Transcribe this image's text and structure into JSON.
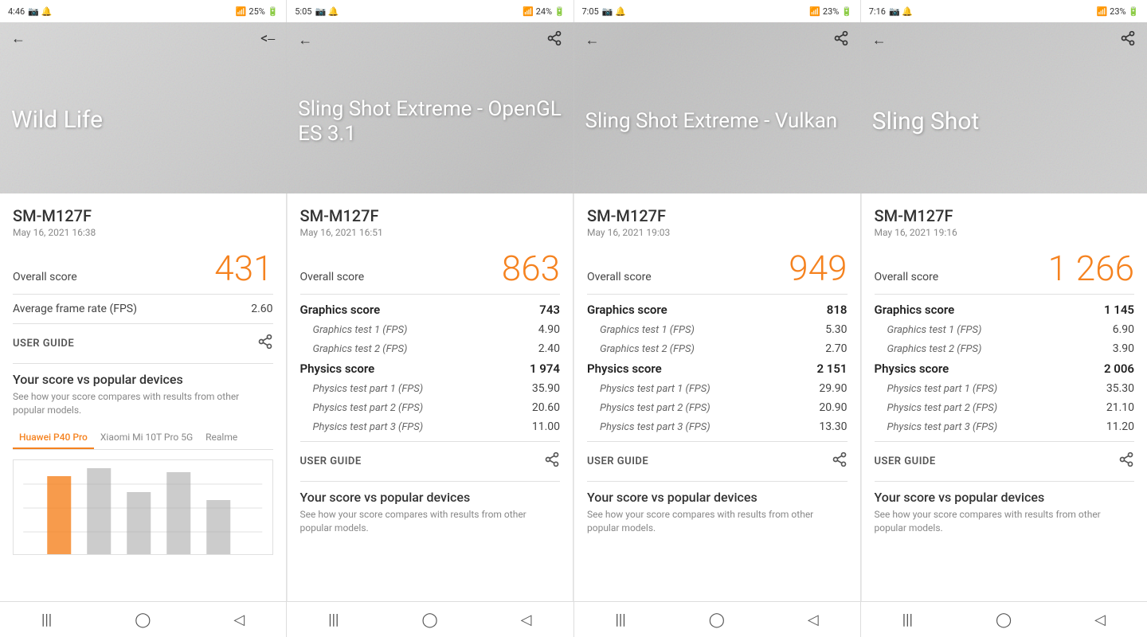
{
  "panels": [
    {
      "id": "wild-life",
      "statusTime": "4:46",
      "statusBattery": "25%",
      "headerTitle": "Wild Life",
      "deviceName": "SM-M127F",
      "deviceDate": "May 16, 2021 16:38",
      "overallLabel": "Overall score",
      "overallValue": "431",
      "avgFpsLabel": "Average frame rate (FPS)",
      "avgFpsValue": "2.60",
      "userGuideLabel": "USER GUIDE",
      "vsTitle": "Your score vs popular devices",
      "vsDesc": "See how your score compares with results from other popular models.",
      "tabs": [
        "Huawei P40 Pro",
        "Xiaomi Mi 10T Pro 5G",
        "Realme"
      ],
      "activeTab": 0,
      "showGraphics": false,
      "showPhysics": false
    },
    {
      "id": "sling-shot-opengl",
      "statusTime": "5:05",
      "statusBattery": "24%",
      "headerTitle": "Sling Shot Extreme - OpenGL ES 3.1",
      "deviceName": "SM-M127F",
      "deviceDate": "May 16, 2021 16:51",
      "overallLabel": "Overall score",
      "overallValue": "863",
      "graphicsLabel": "Graphics score",
      "graphicsValue": "743",
      "graphicsTest1Label": "Graphics test 1 (FPS)",
      "graphicsTest1Value": "4.90",
      "graphicsTest2Label": "Graphics test 2 (FPS)",
      "graphicsTest2Value": "2.40",
      "physicsLabel": "Physics score",
      "physicsValue": "1 974",
      "physicsTest1Label": "Physics test part 1 (FPS)",
      "physicsTest1Value": "35.90",
      "physicsTest2Label": "Physics test part 2 (FPS)",
      "physicsTest2Value": "20.60",
      "physicsTest3Label": "Physics test part 3 (FPS)",
      "physicsTest3Value": "11.00",
      "userGuideLabel": "USER GUIDE",
      "vsTitle": "Your score vs popular devices",
      "vsDesc": "See how your score compares with results from other popular models.",
      "showGraphics": true,
      "showPhysics": true
    },
    {
      "id": "sling-shot-vulkan",
      "statusTime": "7:05",
      "statusBattery": "23%",
      "headerTitle": "Sling Shot Extreme - Vulkan",
      "deviceName": "SM-M127F",
      "deviceDate": "May 16, 2021 19:03",
      "overallLabel": "Overall score",
      "overallValue": "949",
      "graphicsLabel": "Graphics score",
      "graphicsValue": "818",
      "graphicsTest1Label": "Graphics test 1 (FPS)",
      "graphicsTest1Value": "5.30",
      "graphicsTest2Label": "Graphics test 2 (FPS)",
      "graphicsTest2Value": "2.70",
      "physicsLabel": "Physics score",
      "physicsValue": "2 151",
      "physicsTest1Label": "Physics test part 1 (FPS)",
      "physicsTest1Value": "29.90",
      "physicsTest2Label": "Physics test part 2 (FPS)",
      "physicsTest2Value": "20.90",
      "physicsTest3Label": "Physics test part 3 (FPS)",
      "physicsTest3Value": "13.30",
      "userGuideLabel": "USER GUIDE",
      "vsTitle": "Your score vs popular devices",
      "vsDesc": "See how your score compares with results from other popular models.",
      "showGraphics": true,
      "showPhysics": true
    },
    {
      "id": "sling-shot",
      "statusTime": "7:16",
      "statusBattery": "23%",
      "headerTitle": "Sling Shot",
      "deviceName": "SM-M127F",
      "deviceDate": "May 16, 2021 19:16",
      "overallLabel": "Overall score",
      "overallValue": "1 266",
      "graphicsLabel": "Graphics score",
      "graphicsValue": "1 145",
      "graphicsTest1Label": "Graphics test 1 (FPS)",
      "graphicsTest1Value": "6.90",
      "graphicsTest2Label": "Graphics test 2 (FPS)",
      "graphicsTest2Value": "3.90",
      "physicsLabel": "Physics score",
      "physicsValue": "2 006",
      "physicsTest1Label": "Physics test part 1 (FPS)",
      "physicsTest1Value": "35.30",
      "physicsTest2Label": "Physics test part 2 (FPS)",
      "physicsTest2Value": "21.10",
      "physicsTest3Label": "Physics test part 3 (FPS)",
      "physicsTest3Value": "11.20",
      "userGuideLabel": "USER GUIDE",
      "vsTitle": "Your score vs popular devices",
      "vsDesc": "See how your score compares with results from other popular models.",
      "showGraphics": true,
      "showPhysics": true
    }
  ]
}
